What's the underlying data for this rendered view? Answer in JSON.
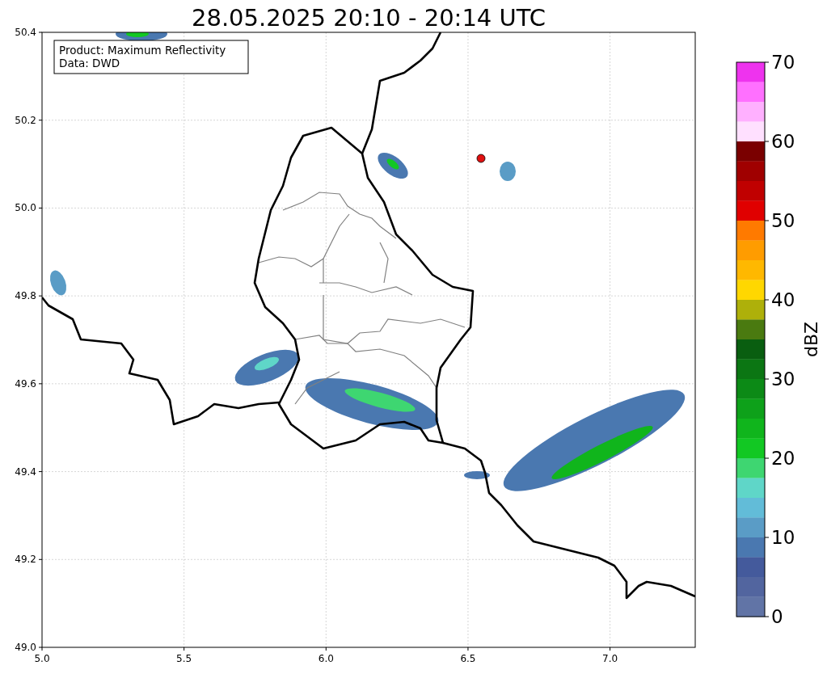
{
  "title": "28.05.2025 20:10 - 20:14 UTC",
  "info_box": {
    "lines": [
      "Product: Maximum Reflectivity",
      "Data: DWD"
    ]
  },
  "map": {
    "x_ticks": [
      "5.0",
      "5.5",
      "6.0",
      "6.5",
      "7.0"
    ],
    "y_ticks": [
      "50.4",
      "50.2",
      "50.0",
      "49.8",
      "49.6",
      "49.4",
      "49.2",
      "49.0"
    ]
  },
  "colorbar": {
    "label": "dBZ",
    "ticks": [
      "70",
      "60",
      "50",
      "40",
      "30",
      "20",
      "10",
      "0"
    ],
    "bands": [
      {
        "color": "#ee33ee"
      },
      {
        "color": "#ff70ff"
      },
      {
        "color": "#ffb0ff"
      },
      {
        "color": "#ffe0ff"
      },
      {
        "color": "#7a0000"
      },
      {
        "color": "#a00000"
      },
      {
        "color": "#c00000"
      },
      {
        "color": "#e00000"
      },
      {
        "color": "#ff7a00"
      },
      {
        "color": "#ff9c00"
      },
      {
        "color": "#ffb800"
      },
      {
        "color": "#ffd700"
      },
      {
        "color": "#aeb00a"
      },
      {
        "color": "#4a7a10"
      },
      {
        "color": "#095e10"
      },
      {
        "color": "#0b7613"
      },
      {
        "color": "#0c8a16"
      },
      {
        "color": "#0ea11a"
      },
      {
        "color": "#10b51c"
      },
      {
        "color": "#12c823"
      },
      {
        "color": "#3ed671"
      },
      {
        "color": "#5fd6c8"
      },
      {
        "color": "#62bcd8"
      },
      {
        "color": "#5a9cc6"
      },
      {
        "color": "#4a78b0"
      },
      {
        "color": "#445a9c"
      },
      {
        "color": "#52659f"
      },
      {
        "color": "#6174a6"
      }
    ]
  }
}
